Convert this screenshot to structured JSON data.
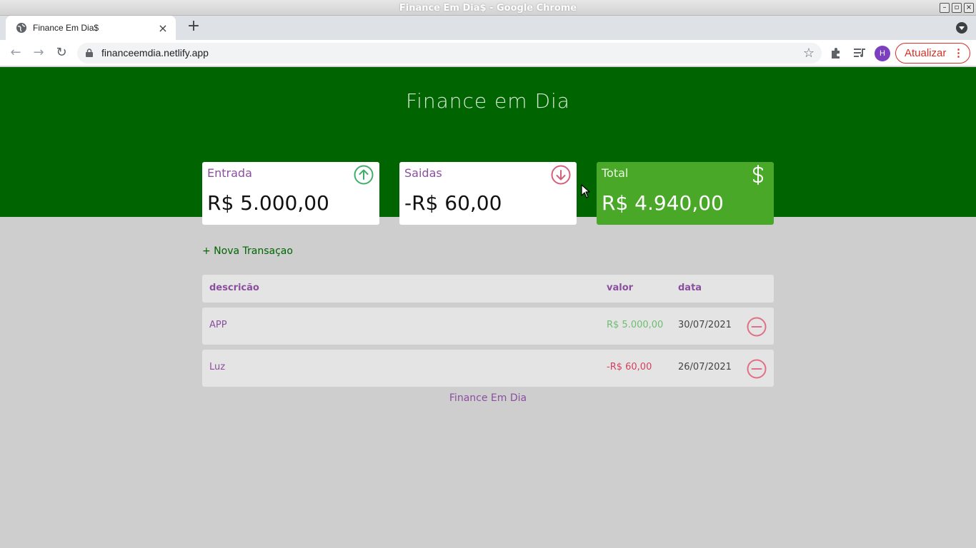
{
  "os": {
    "window_title": "Finance Em Dia$ - Google Chrome",
    "buttons": [
      "–",
      "▫",
      "×"
    ]
  },
  "browser": {
    "tab_title": "Finance Em Dia$",
    "tab_close": "×",
    "new_tab": "+",
    "url": "financeemdia.netlify.app",
    "avatar_letter": "H",
    "update_label": "Atualizar",
    "kebab": "⋮",
    "star": "☆",
    "back": "←",
    "forward": "→",
    "reload": "↻"
  },
  "page": {
    "title": "Finance em Dia",
    "cards": {
      "income": {
        "label": "Entrada",
        "value": "R$ 5.000,00",
        "icon": "arrow-up-circle-icon"
      },
      "expense": {
        "label": "Saidas",
        "value": "-R$ 60,00",
        "icon": "arrow-down-circle-icon"
      },
      "total": {
        "label": "Total",
        "value": "R$ 4.940,00",
        "icon": "dollar-icon"
      }
    },
    "new_transaction": "+ Nova Transaçao",
    "table": {
      "headers": {
        "description": "descricão",
        "value": "valor",
        "date": "data"
      },
      "rows": [
        {
          "description": "APP",
          "value": "R$ 5.000,00",
          "date": "30/07/2021"
        },
        {
          "description": "Luz",
          "value": "-R$ 60,00",
          "date": "26/07/2021"
        }
      ]
    },
    "footer": "Finance Em Dia"
  },
  "colors": {
    "header_green": "#006400",
    "total_card_green": "#4aa829",
    "accent_purple": "#8a4f9e",
    "income_green": "#6bbf6f",
    "expense_red": "#d5405f",
    "background": "#cecece"
  }
}
